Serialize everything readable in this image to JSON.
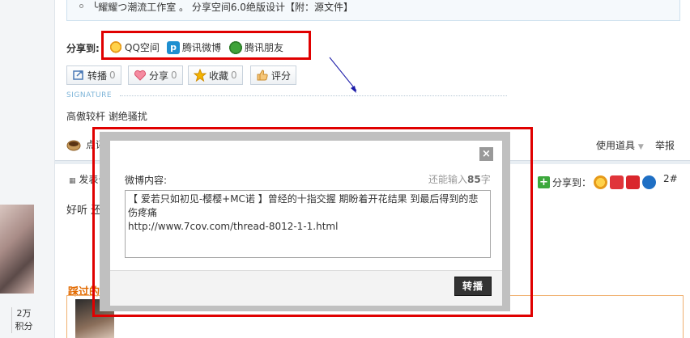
{
  "quote": {
    "text": "╰耀耀つ潮流工作室 。 分享空间6.0绝版设计【附：源文件】"
  },
  "share_bar": {
    "label": "分享到:",
    "items": [
      {
        "label": "QQ空间",
        "icon": "qzone-icon"
      },
      {
        "label": "腾讯微博",
        "icon": "tencent-weibo-icon"
      },
      {
        "label": "腾讯朋友",
        "icon": "tencent-friend-icon"
      }
    ]
  },
  "actions": [
    {
      "label": "转播",
      "count": "0",
      "icon": "repost-icon"
    },
    {
      "label": "分享",
      "count": "0",
      "icon": "heart-icon"
    },
    {
      "label": "收藏",
      "count": "0",
      "icon": "star-icon"
    },
    {
      "label": "评分",
      "count": "",
      "icon": "thumb-icon"
    }
  ],
  "signature": {
    "label": "SIGNATURE",
    "text": "高傲较杆 谢绝骚扰"
  },
  "comment": {
    "label": "点评"
  },
  "toolbar": {
    "tools_label": "使用道具",
    "report_label": "举报"
  },
  "post": {
    "posted_label": "发表于",
    "text": "好听  还有",
    "share_label": "分享到：",
    "floor": "2#"
  },
  "sidebar": {
    "stat_value": "2万",
    "stat_label": "积分"
  },
  "section": {
    "title": "踩过的脚"
  },
  "dialog": {
    "label": "微博内容:",
    "remaining_prefix": "还能输入",
    "remaining_count": "85",
    "remaining_suffix": "字",
    "content_line1": "【 爱若只如初见-樱樱+MC诺 】曾经的十指交握 期盼着开花结果 到最后得到的悲伤疼痛",
    "content_line2": "http://www.7cov.com/thread-8012-1-1.html",
    "submit_label": "转播",
    "close_label": "×"
  },
  "colors": {
    "annotation_red": "#e00000",
    "accent_orange": "#e26a00",
    "link_blue": "#1e8fd0"
  }
}
